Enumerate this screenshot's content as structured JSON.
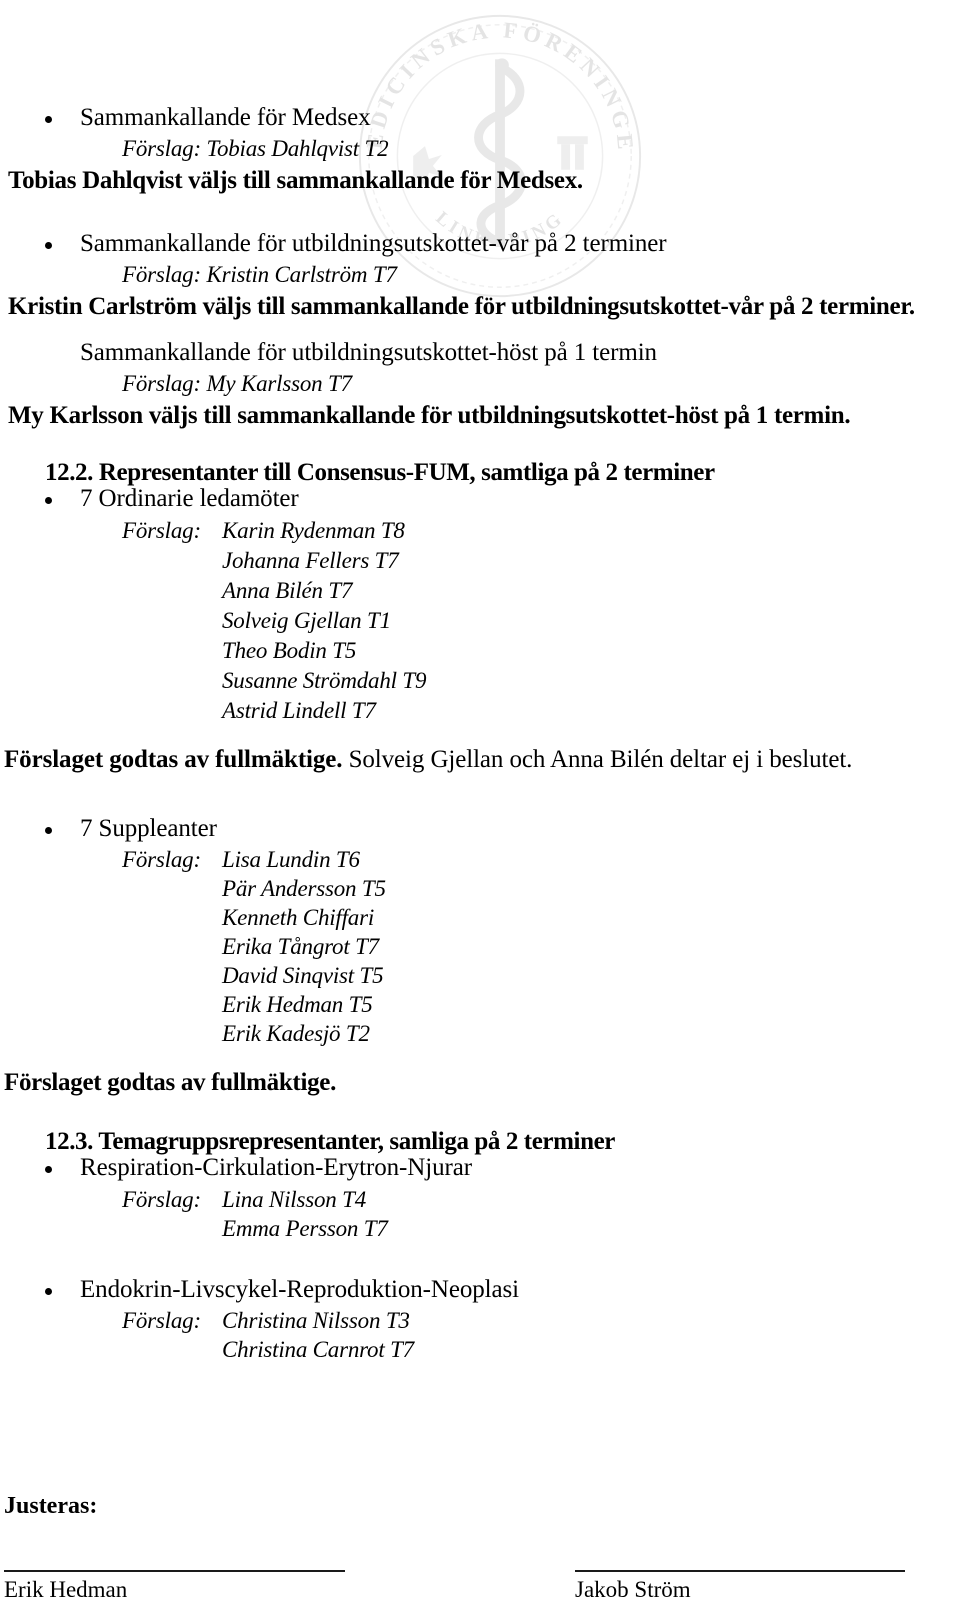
{
  "document": {
    "watermark": {
      "icon": "medicinska-foreningen-seal",
      "outer_text_top": "MEDICINSKA FÖRENINGEN",
      "outer_text_bottom": "LINKÖPING",
      "emblem": "asclepius-rod-with-serpent"
    }
  },
  "blocks": [
    {
      "id": "medsex",
      "bullet": true,
      "title": "Sammankallande för Medsex",
      "forslag_label": "Förslag:",
      "forslag_inline": "Tobias Dahlqvist T2",
      "result": "Tobias Dahlqvist väljs till sammankallande för Medsex."
    },
    {
      "id": "utbildningsutskottet-var",
      "bullet": true,
      "title": "Sammankallande för utbildningsutskottet-vår på 2 terminer",
      "forslag_label": "Förslag:",
      "forslag_inline": "Kristin Carlström T7",
      "result": "Kristin Carlström väljs till sammankallande för utbildningsutskottet-vår på 2 terminer."
    },
    {
      "id": "utbildningsutskottet-host",
      "bullet": false,
      "title": "Sammankallande för utbildningsutskottet-höst på 1 termin",
      "forslag_label": "Förslag:",
      "forslag_inline": "My Karlsson T7",
      "result": "My Karlsson väljs till sammankallande för utbildningsutskottet-höst på 1 termin."
    }
  ],
  "section_12_2": {
    "heading": "12.2. Representanter till Consensus-FUM, samtliga på 2 terminer",
    "ordinarie": {
      "bullet_label": "7 Ordinarie ledamöter",
      "forslag_label": "Förslag:",
      "names": [
        "Karin Rydenman T8",
        "Johanna Fellers T7",
        "Anna Bilén T7",
        "Solveig Gjellan T1",
        "Theo Bodin T5",
        "Susanne Strömdahl T9",
        "Astrid Lindell T7"
      ],
      "decision_bold": "Förslaget godtas av fullmäktige.",
      "decision_rest": " Solveig Gjellan och Anna Bilén deltar ej i beslutet."
    },
    "suppleanter": {
      "bullet_label": "7 Suppleanter",
      "forslag_label": "Förslag:",
      "names": [
        "Lisa Lundin T6",
        "Pär Andersson T5",
        "Kenneth Chiffari",
        "Erika Tångrot T7",
        "David Sinqvist T5",
        "Erik Hedman T5",
        "Erik Kadesjö T2"
      ],
      "decision_bold": "Förslaget godtas av fullmäktige.",
      "decision_rest": ""
    }
  },
  "section_12_3": {
    "heading": "12.3. Temagruppsrepresentanter, samliga på 2 terminer",
    "groups": [
      {
        "bullet_label": "Respiration-Cirkulation-Erytron-Njurar",
        "forslag_label": "Förslag:",
        "names": [
          "Lina Nilsson T4",
          "Emma Persson T7"
        ]
      },
      {
        "bullet_label": "Endokrin-Livscykel-Reproduktion-Neoplasi",
        "forslag_label": "Förslag:",
        "names": [
          "Christina Nilsson T3",
          "Christina Carnrot T7"
        ]
      }
    ]
  },
  "footer": {
    "justeras_label": "Justeras:",
    "signature_left": "Erik Hedman",
    "signature_right": "Jakob Ström"
  }
}
